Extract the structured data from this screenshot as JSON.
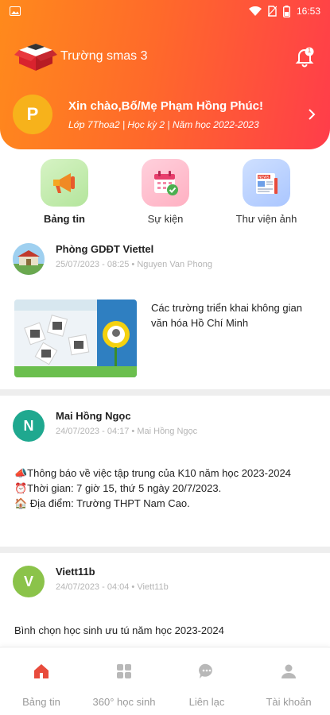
{
  "status_bar": {
    "time": "16:53"
  },
  "header": {
    "school_name": "Trường smas 3",
    "notification_count": "1"
  },
  "greeting": {
    "avatar_letter": "P",
    "title": "Xin chào,Bố/Mẹ Phạm Hồng Phúc!",
    "subtitle": "Lớp 7Thoa2 | Học kỳ 2 | Năm học 2022-2023"
  },
  "quick_menu": [
    {
      "label": "Bảng tin",
      "icon": "megaphone-icon"
    },
    {
      "label": "Sự kiện",
      "icon": "calendar-icon"
    },
    {
      "label": "Thư viện ảnh",
      "icon": "news-icon"
    }
  ],
  "posts": [
    {
      "author": "Phòng GDĐT Viettel",
      "date": "25/07/2023 - 08:25",
      "by": "Nguyen Van Phong",
      "body": "Các trường triển khai không gian văn hóa Hồ Chí Minh"
    },
    {
      "avatar_letter": "N",
      "avatar_color": "#1fa88f",
      "author": "Mai Hồng Ngọc",
      "date": "24/07/2023 - 04:17",
      "by": "Mai Hồng Ngọc",
      "line1": "📣Thông báo về việc tập trung của K10 năm học 2023-2024",
      "line2": "⏰Thời gian: 7 giờ 15, thứ 5 ngày 20/7/2023.",
      "line3": "🏠  Địa điểm: Trường THPT Nam Cao."
    },
    {
      "avatar_letter": "V",
      "avatar_color": "#8bc34a",
      "author": "Viett11b",
      "date": "24/07/2023 - 04:04",
      "by": "Viett11b",
      "body": "Bình chọn học sinh ưu tú năm học 2023-2024"
    }
  ],
  "bottom_nav": [
    {
      "label": "Bảng tin",
      "icon": "home-icon",
      "active": true
    },
    {
      "label": "360° học sinh",
      "icon": "grid-icon",
      "active": false
    },
    {
      "label": "Liên lạc",
      "icon": "chat-icon",
      "active": false
    },
    {
      "label": "Tài khoản",
      "icon": "user-icon",
      "active": false
    }
  ],
  "colors": {
    "accent": "#ff5a2e",
    "gradient_start": "#ff8a1c",
    "gradient_end": "#ff3d4a",
    "nav_active": "#e84b3c"
  }
}
